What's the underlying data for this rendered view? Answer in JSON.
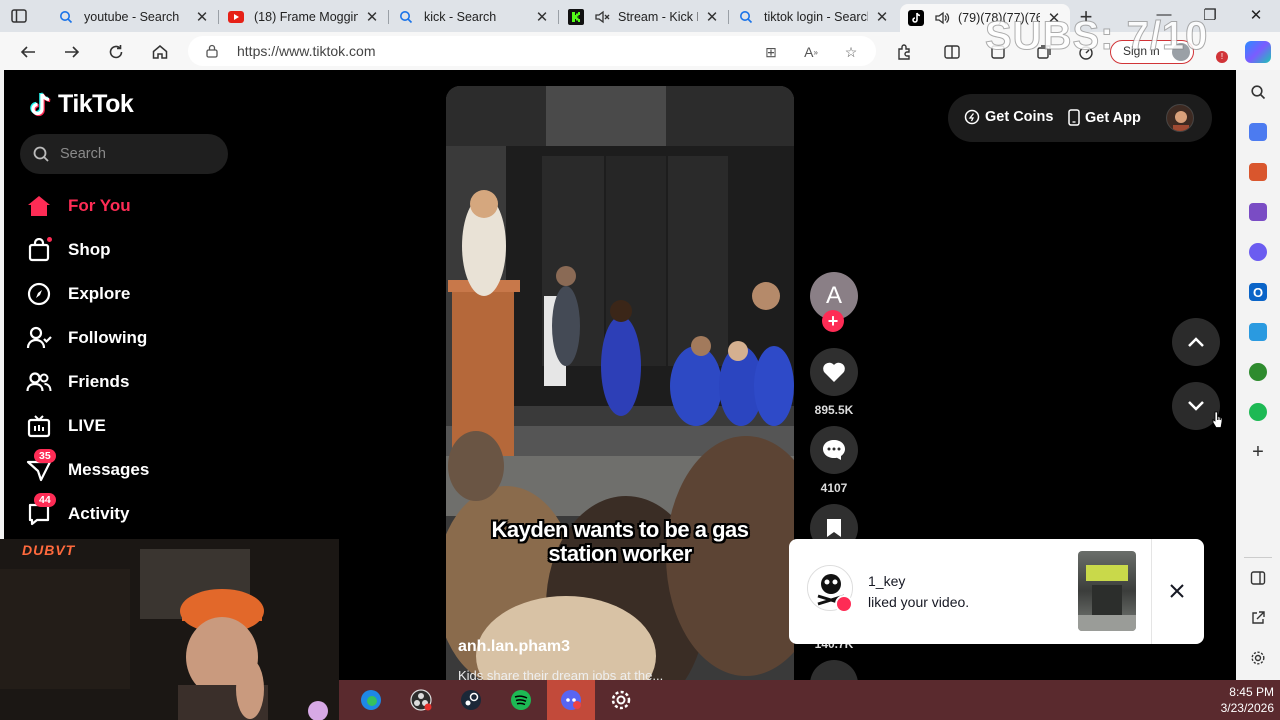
{
  "browser": {
    "tabs": [
      {
        "title": "youtube - Search",
        "icon": "search-icon",
        "active": false
      },
      {
        "title": "(18) Frame Mogging",
        "icon": "youtube-icon",
        "active": false
      },
      {
        "title": "kick - Search",
        "icon": "search-icon",
        "active": false
      },
      {
        "title": "Stream - Kick D",
        "icon": "kick-icon",
        "active": false
      },
      {
        "title": "tiktok login - Search",
        "icon": "search-icon",
        "active": false
      },
      {
        "title": "(79)(78)(77)(76",
        "icon": "tiktok-icon",
        "active": true
      }
    ],
    "url": "https://www.tiktok.com",
    "signin_label": "Sign in",
    "overlay_text": "SUBS: 7/10"
  },
  "sidebar": {
    "logo": "TikTok",
    "search_placeholder": "Search",
    "items": [
      {
        "label": "For You",
        "icon": "home-icon",
        "active": true
      },
      {
        "label": "Shop",
        "icon": "shopping-bag-icon",
        "active": false
      },
      {
        "label": "Explore",
        "icon": "compass-icon",
        "active": false
      },
      {
        "label": "Following",
        "icon": "user-follow-icon",
        "active": false
      },
      {
        "label": "Friends",
        "icon": "friends-icon",
        "active": false
      },
      {
        "label": "LIVE",
        "icon": "live-tv-icon",
        "active": false
      },
      {
        "label": "Messages",
        "icon": "messages-icon",
        "active": false,
        "badge": "35"
      },
      {
        "label": "Activity",
        "icon": "activity-icon",
        "active": false,
        "badge": "44"
      }
    ]
  },
  "video": {
    "caption_line1": "Kayden wants to be a gas",
    "caption_line2": "station worker",
    "username": "anh.lan.pham3",
    "description": "Kids share their dream jobs at the..."
  },
  "actions": {
    "avatar_letter": "A",
    "likes": "895.5K",
    "comments": "4107",
    "saves": "140.7K"
  },
  "topbar": {
    "get_coins": "Get Coins",
    "get_app": "Get App"
  },
  "notification": {
    "user": "1_key",
    "text": "liked your video."
  },
  "webcam": {
    "tag": "DUBVT"
  },
  "clock": {
    "time": "8:45 PM",
    "date": "3/23/2026"
  }
}
